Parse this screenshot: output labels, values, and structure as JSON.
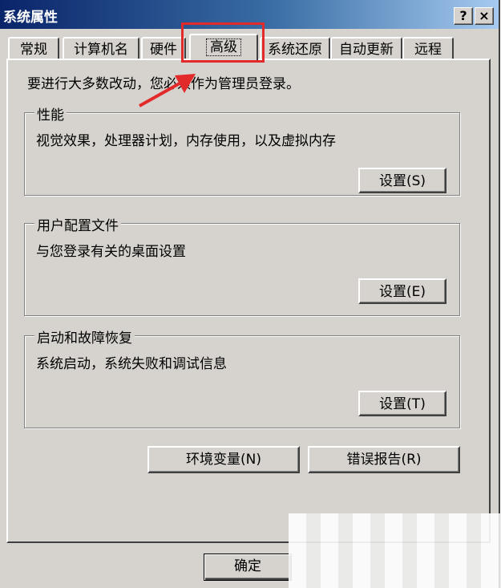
{
  "window": {
    "title": "系统属性",
    "help_button": "?",
    "close_button": "×"
  },
  "tabs": [
    {
      "label": "常规"
    },
    {
      "label": "计算机名"
    },
    {
      "label": "硬件"
    },
    {
      "label": "高级",
      "active": true
    },
    {
      "label": "系统还原"
    },
    {
      "label": "自动更新"
    },
    {
      "label": "远程"
    }
  ],
  "admin_note": "要进行大多数改动，您必须作为管理员登录。",
  "groups": {
    "performance": {
      "title": "性能",
      "description": "视觉效果，处理器计划，内存使用，以及虚拟内存",
      "button": "设置(S)"
    },
    "user_profiles": {
      "title": "用户配置文件",
      "description": "与您登录有关的桌面设置",
      "button": "设置(E)"
    },
    "startup_recovery": {
      "title": "启动和故障恢复",
      "description": "系统启动，系统失败和调试信息",
      "button": "设置(T)"
    }
  },
  "buttons": {
    "env_vars": "环境变量(N)",
    "error_report": "错误报告(R)",
    "ok": "确定"
  },
  "colors": {
    "highlight_red": "#e32a2a",
    "titlebar_blue": "#0a246a",
    "dialog_gray": "#d6d3ce"
  }
}
